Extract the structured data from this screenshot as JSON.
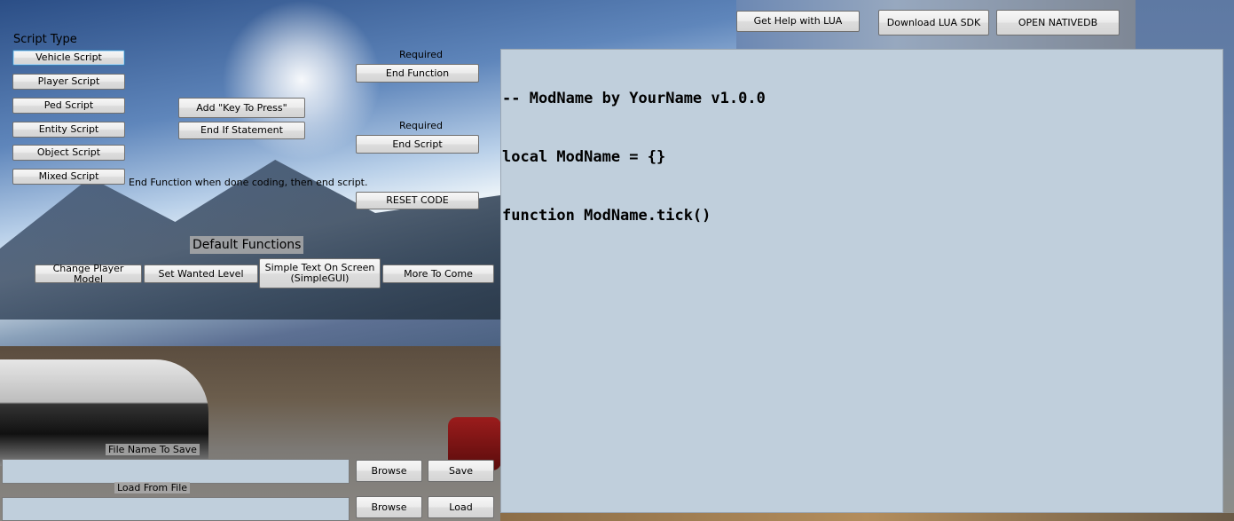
{
  "top_buttons": {
    "help_lua": "Get Help with LUA",
    "download_sdk": "Download LUA SDK",
    "open_nativedb": "OPEN NATIVEDB"
  },
  "script_type": {
    "heading": "Script Type",
    "buttons": [
      "Vehicle Script",
      "Player Script",
      "Ped Script",
      "Entity Script",
      "Object Script",
      "Mixed Script"
    ]
  },
  "middle": {
    "add_key": "Add \"Key To Press\"",
    "end_if": "End If Statement",
    "required_1": "Required",
    "end_function": "End Function",
    "required_2": "Required",
    "end_script": "End Script",
    "hint": "End Function when done coding, then end script.",
    "reset_code": "RESET CODE"
  },
  "default_functions": {
    "heading": "Default Functions",
    "buttons": [
      "Change Player Model",
      "Set Wanted Level",
      "Simple Text On Screen\n(SimpleGUI)",
      "More To Come"
    ]
  },
  "file": {
    "save_label": "File Name To Save",
    "save_value": "",
    "browse_1": "Browse",
    "save": "Save",
    "load_label": "Load From File",
    "load_value": "",
    "browse_2": "Browse",
    "load": "Load"
  },
  "editor": {
    "lines": [
      "-- ModName by YourName v1.0.0",
      "local ModName = {}",
      "function ModName.tick()"
    ]
  }
}
